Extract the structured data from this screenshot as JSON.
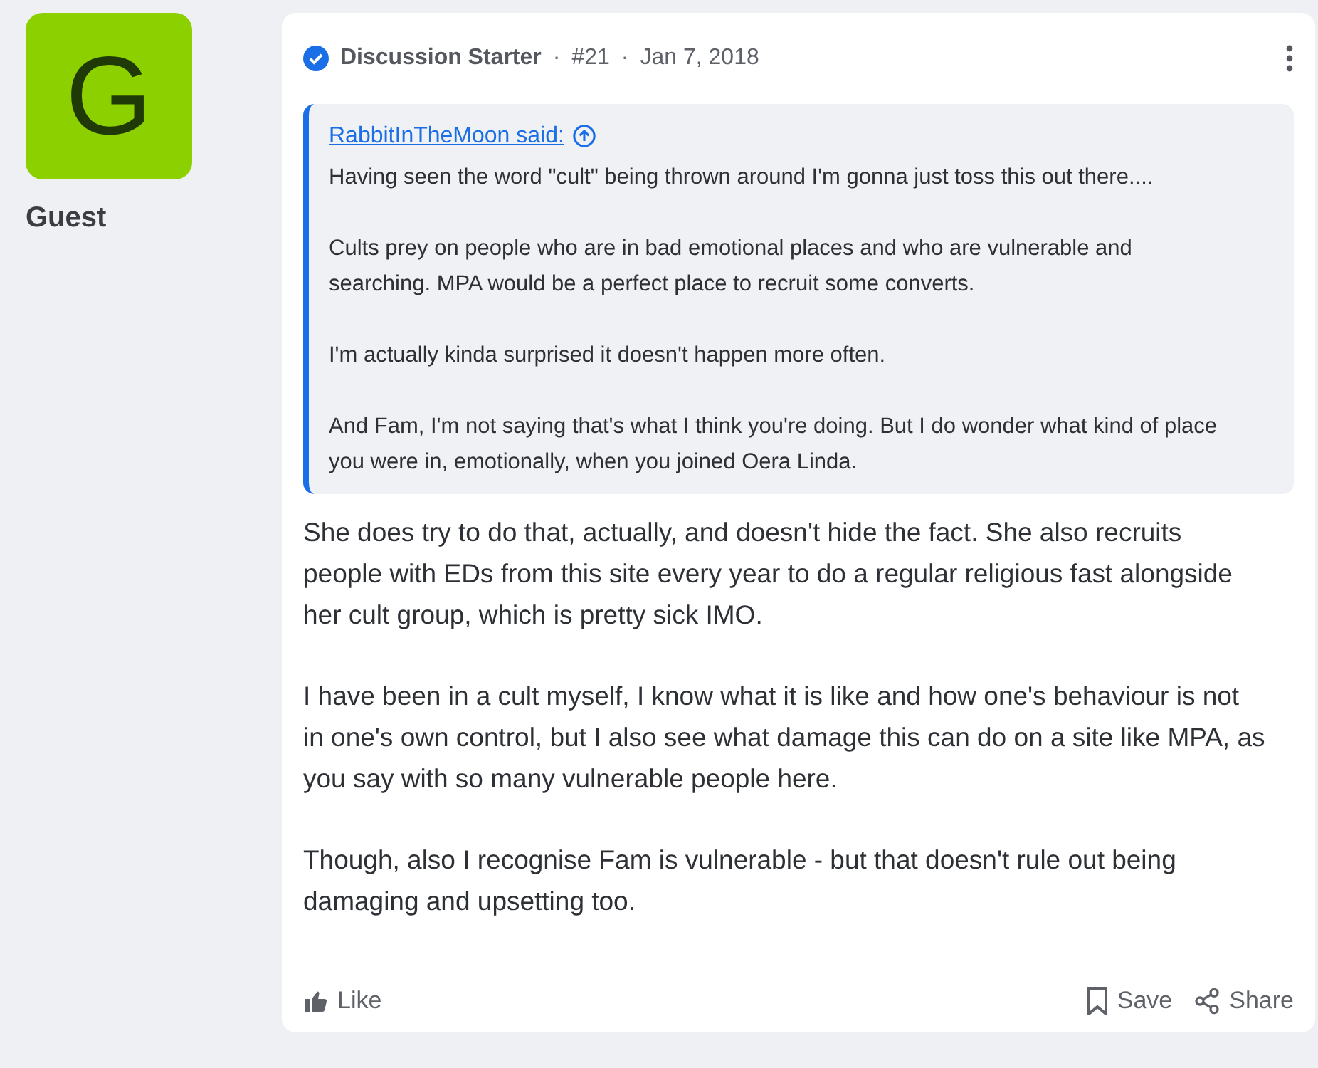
{
  "author": {
    "initial": "G",
    "name": "Guest"
  },
  "post": {
    "badge": "Discussion Starter",
    "number": "#21",
    "date": "Jan 7, 2018",
    "separator": "·",
    "quote": {
      "author": "RabbitInTheMoon said:",
      "paragraphs": [
        "Having seen the word \"cult\" being thrown around I'm gonna just toss this out there....",
        "Cults prey on people who are in bad emotional places and who are vulnerable and searching. MPA would be a perfect place to recruit some converts.",
        "I'm actually kinda surprised it doesn't happen more often.",
        "And Fam, I'm not saying that's what I think you're doing. But I do wonder what kind of place you were in, emotionally, when you joined Oera Linda."
      ]
    },
    "paragraphs": [
      "She does try to do that, actually, and doesn't hide the fact. She also recruits people with EDs from this site every year to do a regular religious fast alongside her cult group, which is pretty sick IMO.",
      "I have been in a cult myself, I know what it is like and how one's behaviour is not in one's own control, but I also see what damage this can do on a site like MPA, as you say with so many vulnerable people here.",
      "Though, also I recognise Fam is vulnerable - but that doesn't rule out being damaging and upsetting too."
    ],
    "actions": [
      {
        "kind": "like",
        "label": "Like"
      },
      {
        "kind": "save",
        "label": "Save"
      },
      {
        "kind": "share",
        "label": "Share"
      }
    ]
  }
}
